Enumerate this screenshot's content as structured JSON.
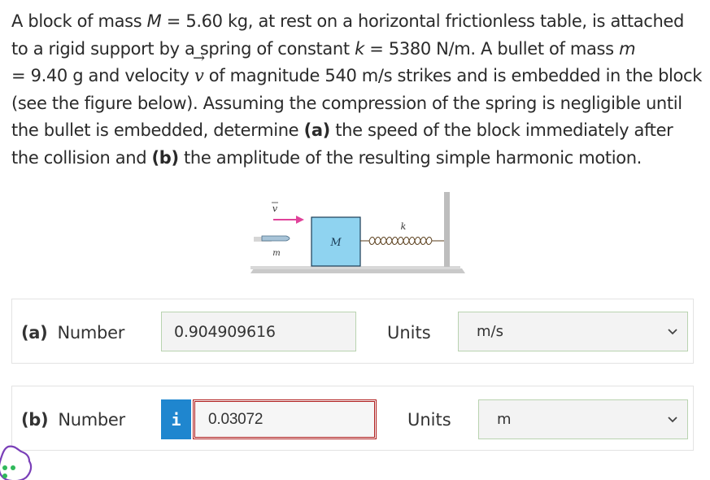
{
  "problem": {
    "seg1": "A block of mass ",
    "mass_symbol": "M",
    "seg2": " = 5.60 kg, at rest on a horizontal frictionless table, is attached to a rigid support by a spring of constant ",
    "k_symbol": "k",
    "seg3": " = 5380 N/m. A bullet of mass ",
    "m_symbol": "m",
    "seg4": " = 9.40 g and velocity ",
    "v_symbol": "v",
    "seg5": " of magnitude 540 m/s strikes and is embedded in the block (see the figure below). Assuming the compression of the spring is negligible until the bullet is embedded, determine ",
    "part_a": "(a)",
    "seg6": " the speed of the block immediately after the collision and ",
    "part_b": "(b)",
    "seg7": " the amplitude of the resulting simple harmonic motion."
  },
  "figure": {
    "velocity_label": "v",
    "bullet_label": "m",
    "block_label": "M",
    "spring_label": "k",
    "colors": {
      "block": "#8fd3f0",
      "arrow": "#e0429a",
      "shadow": "#bdbdbd"
    }
  },
  "answers": [
    {
      "part": "(a)",
      "number_label": "Number",
      "value": "0.904909616",
      "units_label": "Units",
      "unit": "m/s",
      "status": "correct"
    },
    {
      "part": "(b)",
      "number_label": "Number",
      "value": "0.03072",
      "units_label": "Units",
      "unit": "m",
      "status": "incorrect",
      "info_icon": "i"
    }
  ]
}
